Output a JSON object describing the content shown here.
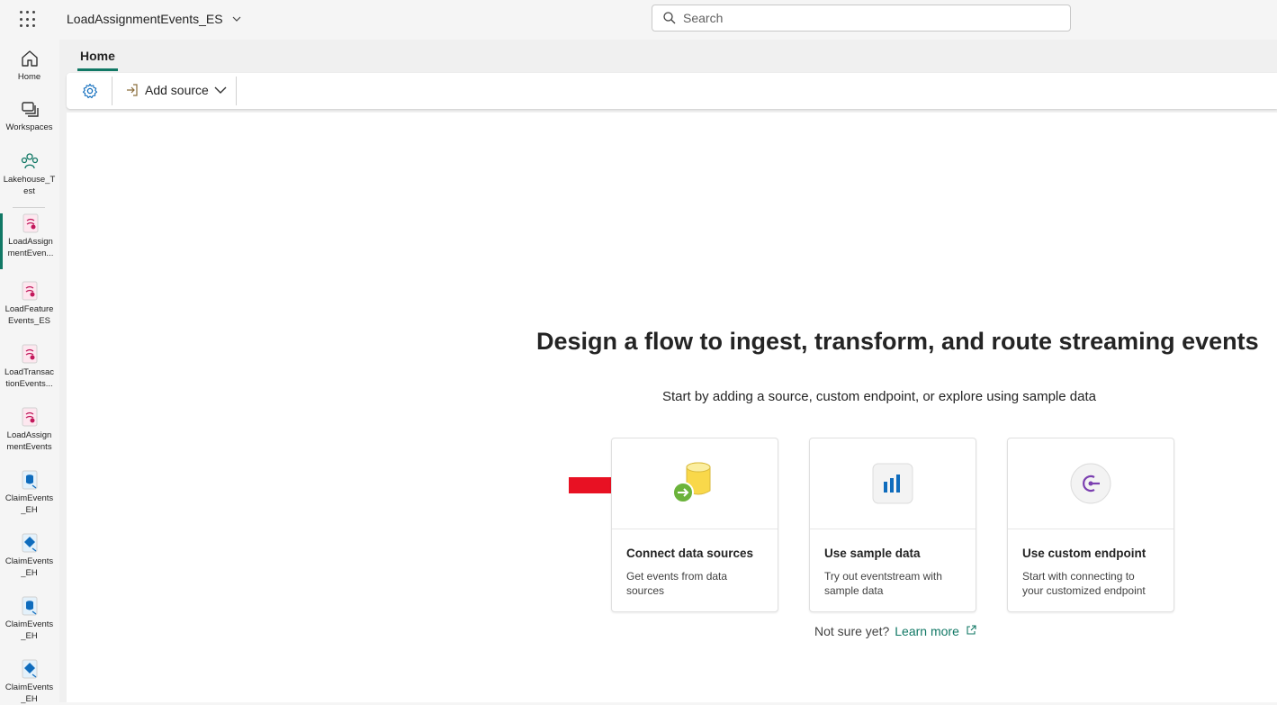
{
  "topbar": {
    "app_title": "LoadAssignmentEvents_ES",
    "search_placeholder": "Search"
  },
  "leftnav": {
    "items": [
      {
        "label": "Home",
        "icon": "home-icon"
      },
      {
        "label": "Workspaces",
        "icon": "workspaces-icon"
      },
      {
        "label": "Lakehouse_T est",
        "icon": "workspace-people-icon"
      },
      {
        "label": "LoadAssign mentEven...",
        "icon": "eventstream-icon",
        "active": true
      },
      {
        "label": "LoadFeature Events_ES",
        "icon": "eventstream-icon"
      },
      {
        "label": "LoadTransac tionEvents...",
        "icon": "eventstream-icon"
      },
      {
        "label": "LoadAssign mentEvents",
        "icon": "eventstream-icon"
      },
      {
        "label": "ClaimEvents _EH",
        "icon": "eventhouse-icon"
      },
      {
        "label": "ClaimEvents _EH",
        "icon": "kql-database-icon"
      },
      {
        "label": "ClaimEvents _EH",
        "icon": "eventhouse-icon"
      },
      {
        "label": "ClaimEvents _EH",
        "icon": "kql-database-icon"
      }
    ]
  },
  "tabs": {
    "home": "Home"
  },
  "ribbon": {
    "add_source": "Add source"
  },
  "main": {
    "headline": "Design a flow to ingest, transform, and route streaming events",
    "subline": "Start by adding a source, custom endpoint, or explore using sample data",
    "cards": [
      {
        "title": "Connect data sources",
        "desc": "Get events from data sources",
        "icon": "database-connect-icon"
      },
      {
        "title": "Use sample data",
        "desc": "Try out eventstream with sample data",
        "icon": "bar-chart-icon"
      },
      {
        "title": "Use custom endpoint",
        "desc": "Start with connecting to your customized endpoint",
        "icon": "endpoint-icon"
      }
    ],
    "not_sure": "Not sure yet?",
    "learn_more": "Learn more"
  },
  "colors": {
    "accent": "#117865",
    "annotation_arrow": "#e81123"
  }
}
